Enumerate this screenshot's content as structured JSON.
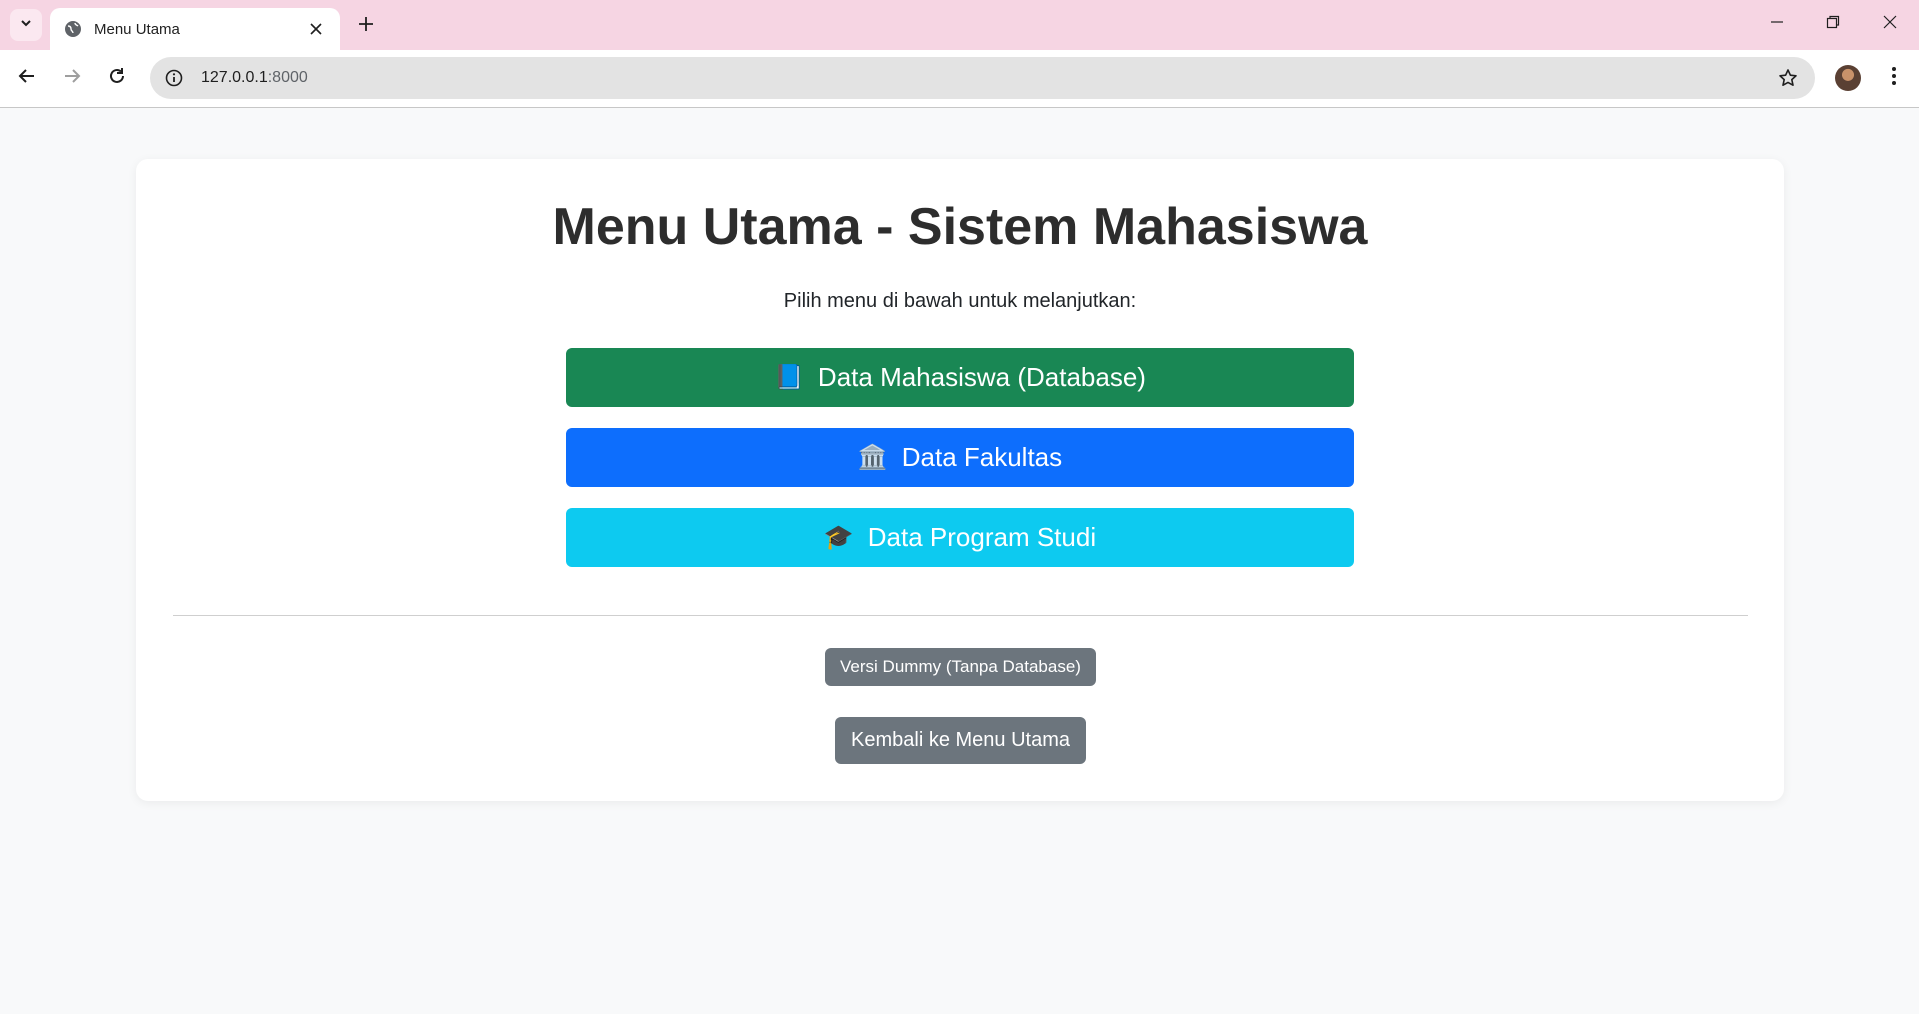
{
  "browser": {
    "tab_title": "Menu Utama",
    "url_host": "127.0.0.1",
    "url_port": ":8000"
  },
  "page": {
    "title": "Menu Utama - Sistem Mahasiswa",
    "subtitle": "Pilih menu di bawah untuk melanjutkan:",
    "menu": [
      {
        "icon": "📘",
        "icon_name": "blue-book-icon",
        "label": "Data Mahasiswa (Database)",
        "color": "#198754"
      },
      {
        "icon": "🏛️",
        "icon_name": "classical-building-icon",
        "label": "Data Fakultas",
        "color": "#0d6efd"
      },
      {
        "icon": "🎓",
        "icon_name": "graduation-cap-icon",
        "label": "Data Program Studi",
        "color": "#0dcaf0"
      }
    ],
    "dummy_button": "Versi Dummy (Tanpa Database)",
    "back_button": "Kembali ke Menu Utama",
    "secondary_color": "#6c757d"
  },
  "colors": {
    "tabbar_bg": "#f6d5e3",
    "page_bg": "#f8f9fa"
  }
}
